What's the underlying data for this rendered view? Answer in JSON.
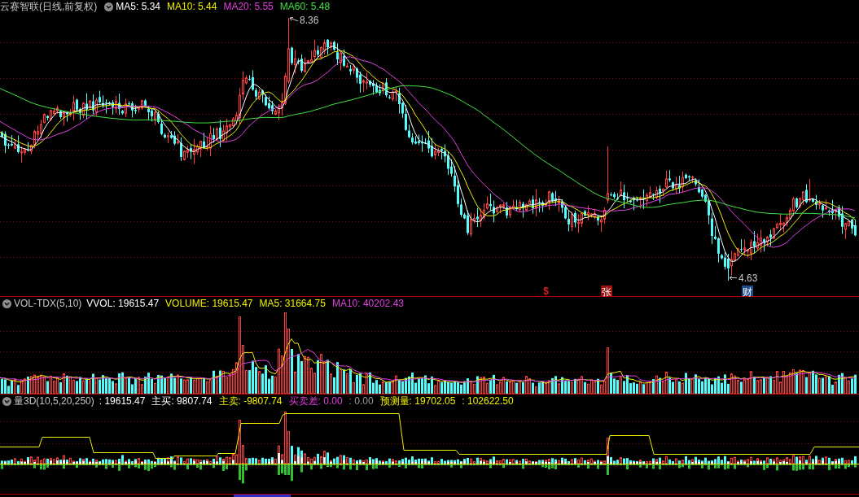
{
  "main_chart": {
    "title": "云赛智联(日线,前复权)",
    "indicators": [
      {
        "label": "MA5: 5.34",
        "color": "#ffffff"
      },
      {
        "label": "MA10: 5.44",
        "color": "#f0f000"
      },
      {
        "label": "MA20: 5.55",
        "color": "#e040e0"
      },
      {
        "label": "MA60: 5.48",
        "color": "#40e040"
      }
    ],
    "high_label": "8.36",
    "low_label": "4.63",
    "event_markers": [
      {
        "text": "$",
        "kind": "plain",
        "color": "#e02020"
      },
      {
        "text": "张",
        "kind": "badge",
        "color": "#a01010"
      },
      {
        "text": "财",
        "kind": "badge",
        "color": "#1c4f8c"
      }
    ]
  },
  "volume_panel": {
    "title": "VOL-TDX(5,10)",
    "indicators": [
      {
        "label": "VVOL: 19615.47",
        "color": "#ffffff"
      },
      {
        "label": "VOLUME: 19615.47",
        "color": "#f0f000"
      },
      {
        "label": "MA5: 31664.75",
        "color": "#f0f000"
      },
      {
        "label": "MA10: 40202.43",
        "color": "#e040e0"
      }
    ]
  },
  "flow_panel": {
    "title": "量3D(10,5,20,250)",
    "indicators": [
      {
        "label": ": 19615.47",
        "color": "#ffffff"
      },
      {
        "label": "主买: 9807.74",
        "color": "#ffffff"
      },
      {
        "label": "主卖: -9807.74",
        "color": "#f0f000"
      },
      {
        "label": "买卖差: 0.00",
        "color": "#e040e0"
      },
      {
        "label": ": 0.00",
        "color": "#9a9a9a"
      },
      {
        "label": "预测量: 19702.05",
        "color": "#f0f000"
      },
      {
        "label": ": 102622.50",
        "color": "#f0f000"
      }
    ]
  }
}
